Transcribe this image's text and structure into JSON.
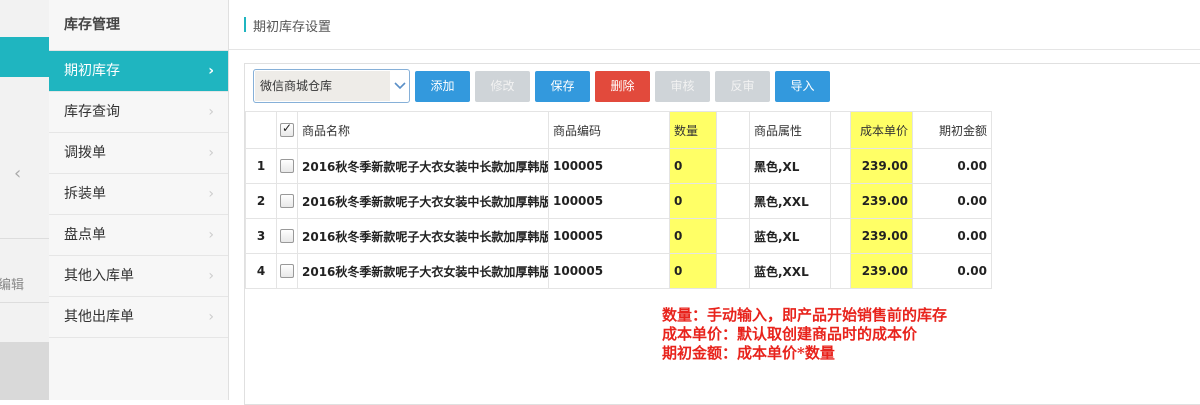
{
  "left_strip": {
    "edit_label": "编辑"
  },
  "sidebar": {
    "title": "库存管理",
    "items": [
      {
        "label": "期初库存",
        "active": true
      },
      {
        "label": "库存查询"
      },
      {
        "label": "调拨单"
      },
      {
        "label": "拆装单"
      },
      {
        "label": "盘点单"
      },
      {
        "label": "其他入库单"
      },
      {
        "label": "其他出库单"
      }
    ]
  },
  "page": {
    "title": "期初库存设置"
  },
  "toolbar": {
    "warehouse": "微信商城仓库",
    "add": "添加",
    "edit": "修改",
    "save": "保存",
    "delete": "删除",
    "audit": "审核",
    "unaudit": "反审",
    "import": "导入"
  },
  "table": {
    "headers": {
      "name": "商品名称",
      "code": "商品编码",
      "qty": "数量",
      "attr": "商品属性",
      "price": "成本单价",
      "opening": "期初金额"
    },
    "rows": [
      {
        "idx": "1",
        "name": "2016秋冬季新款呢子大衣女装中长款加厚韩版",
        "code": "100005",
        "qty": "0",
        "attr": "黑色,XL",
        "price": "239.00",
        "opening": "0.00"
      },
      {
        "idx": "2",
        "name": "2016秋冬季新款呢子大衣女装中长款加厚韩版",
        "code": "100005",
        "qty": "0",
        "attr": "黑色,XXL",
        "price": "239.00",
        "opening": "0.00"
      },
      {
        "idx": "3",
        "name": "2016秋冬季新款呢子大衣女装中长款加厚韩版",
        "code": "100005",
        "qty": "0",
        "attr": "蓝色,XL",
        "price": "239.00",
        "opening": "0.00"
      },
      {
        "idx": "4",
        "name": "2016秋冬季新款呢子大衣女装中长款加厚韩版",
        "code": "100005",
        "qty": "0",
        "attr": "蓝色,XXL",
        "price": "239.00",
        "opening": "0.00"
      }
    ]
  },
  "annotation": {
    "line1": "数量：手动输入，即产品开始销售前的库存",
    "line2": "成本单价：默认取创建商品时的成本价",
    "line3": "期初金额：成本单价*数量"
  },
  "colors": {
    "accent": "#1fb5c0",
    "primary_button": "#3399dd",
    "danger_button": "#e24a3c",
    "disabled_button": "#cfd4d8",
    "highlight_column": "#ffff66",
    "annotation_text": "#e8231c"
  }
}
